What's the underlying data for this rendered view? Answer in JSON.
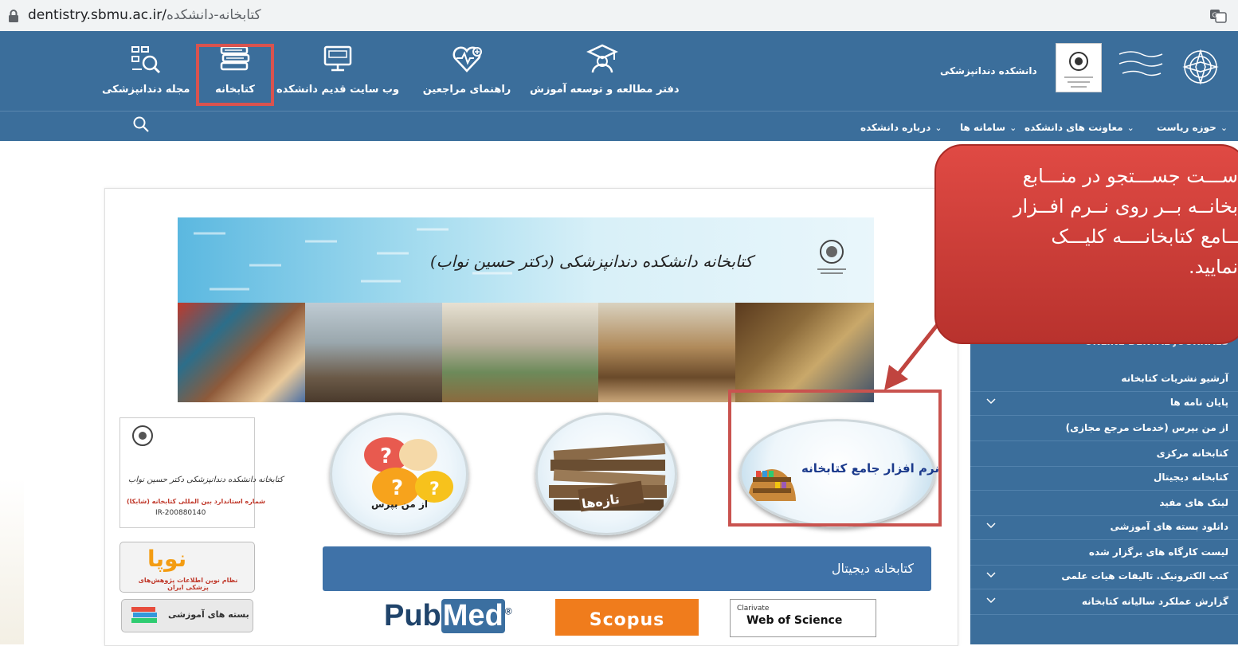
{
  "address_bar": {
    "host": "dentistry.sbmu.ac.ir/",
    "path": "کتابخانه-دانشکده"
  },
  "header": {
    "nav_tiles": [
      {
        "label": "مجله دندانپزشکی",
        "icon": "research-icon"
      },
      {
        "label": "کتابخانه",
        "icon": "books-icon"
      },
      {
        "label": "وب سایت قدیم دانشکده",
        "icon": "monitor-icon"
      },
      {
        "label": "راهنمای مراجعین",
        "icon": "heartbeat-icon"
      },
      {
        "label": "دفتر مطالعه و توسعه آموزش",
        "icon": "graduate-icon"
      }
    ],
    "brand_name": "دانشکده دندانپزشکی"
  },
  "subnav": {
    "items": [
      "حوزه ریاست",
      "معاونت های دانشکده",
      "سامانه ها",
      "درباره دانشکده"
    ]
  },
  "callout": {
    "lines": [
      "ســـت جســـتجو در منـــابع",
      "بخانــه بــر روی نــرم افــزار",
      "ــامع کتابخانــــه کلیـــک",
      "نمایید."
    ]
  },
  "sidebar": {
    "heading": "ONLINE DENTAL JOURNALS",
    "items": [
      {
        "label": "آرشیو نشریات کتابخانه",
        "expandable": false
      },
      {
        "label": "پایان نامه ها",
        "expandable": true
      },
      {
        "label": "از من بپرس (خدمات مرجع مجازی)",
        "expandable": false
      },
      {
        "label": "کتابخانه مرکزی",
        "expandable": false
      },
      {
        "label": "کتابخانه دیجیتال",
        "expandable": false
      },
      {
        "label": "لینک های مفید",
        "expandable": false
      },
      {
        "label": "دانلود بسته های آموزشی",
        "expandable": true
      },
      {
        "label": "لیست کارگاه های برگزار شده",
        "expandable": false
      },
      {
        "label": "کتب الکترونیک. تالیفات هیات علمی",
        "expandable": true
      },
      {
        "label": "گزارش عملکرد سالیانه کتابخانه",
        "expandable": true
      }
    ]
  },
  "banner": {
    "title": "کتابخانه دانشکده دندانپزشکی (دکتر حسین نواب)"
  },
  "circles": {
    "ask_me": "از من بپرس",
    "new_books": "تازه‌ها",
    "library_software": "نرم افزار جامع کتابخانه"
  },
  "badge": {
    "title": "کتابخانه دانشکده دندانپزشکی دکتر حسین نواب",
    "issn_label": "شماره استاندارد بین المللی کتابخانه (شابکا)",
    "issn_value": "IR-200880140"
  },
  "noopa": {
    "logo": "نوپا",
    "caption": "نظام نوین اطلاعات پژوهش‌های پزشکی ایران"
  },
  "packs": {
    "label": "بسته های آموزشی"
  },
  "digital_library": {
    "title": "کتابخانه دیجیتال",
    "logos": {
      "pubmed_a": "Pub",
      "pubmed_b": "Med",
      "scopus": "Scopus",
      "wos_top": "Clarivate",
      "wos_main": "Web of Science"
    }
  },
  "colors": {
    "header_blue": "#3b6e9b",
    "callout_red": "#d63c3c",
    "highlight_red": "#d9534f",
    "scopus_orange": "#f07c1c"
  }
}
